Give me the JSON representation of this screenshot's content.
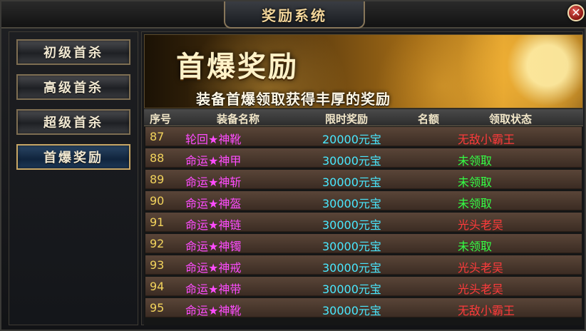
{
  "window": {
    "title": "奖励系统"
  },
  "menu": {
    "items": [
      {
        "label": "初级首杀",
        "active": false
      },
      {
        "label": "高级首杀",
        "active": false
      },
      {
        "label": "超级首杀",
        "active": false
      },
      {
        "label": "首爆奖励",
        "active": true
      }
    ]
  },
  "banner": {
    "title": "首爆奖励",
    "subtitle": "装备首爆领取获得丰厚的奖励"
  },
  "table": {
    "headers": [
      "序号",
      "装备名称",
      "限时奖励",
      "名额",
      "领取状态"
    ],
    "rows": [
      {
        "id": "87",
        "name": "轮回★神靴",
        "prize": "20000元宝",
        "quota": "",
        "status": "无敌小霸王",
        "status_color": "#ff3b3b"
      },
      {
        "id": "88",
        "name": "命运★神甲",
        "prize": "30000元宝",
        "quota": "",
        "status": "未领取",
        "status_color": "#34ff45"
      },
      {
        "id": "89",
        "name": "命运★神斩",
        "prize": "30000元宝",
        "quota": "",
        "status": "未领取",
        "status_color": "#34ff45"
      },
      {
        "id": "90",
        "name": "命运★神盔",
        "prize": "30000元宝",
        "quota": "",
        "status": "未领取",
        "status_color": "#34ff45"
      },
      {
        "id": "91",
        "name": "命运★神链",
        "prize": "30000元宝",
        "quota": "",
        "status": "光头老吴",
        "status_color": "#ff3b3b"
      },
      {
        "id": "92",
        "name": "命运★神镯",
        "prize": "30000元宝",
        "quota": "",
        "status": "未领取",
        "status_color": "#34ff45"
      },
      {
        "id": "93",
        "name": "命运★神戒",
        "prize": "30000元宝",
        "quota": "",
        "status": "光头老吴",
        "status_color": "#ff3b3b"
      },
      {
        "id": "94",
        "name": "命运★神带",
        "prize": "30000元宝",
        "quota": "",
        "status": "光头老吴",
        "status_color": "#ff3b3b"
      },
      {
        "id": "95",
        "name": "命运★神靴",
        "prize": "30000元宝",
        "quota": "",
        "status": "无敌小霸王",
        "status_color": "#ff3b3b"
      }
    ]
  },
  "icons": {
    "close": "close-icon"
  }
}
